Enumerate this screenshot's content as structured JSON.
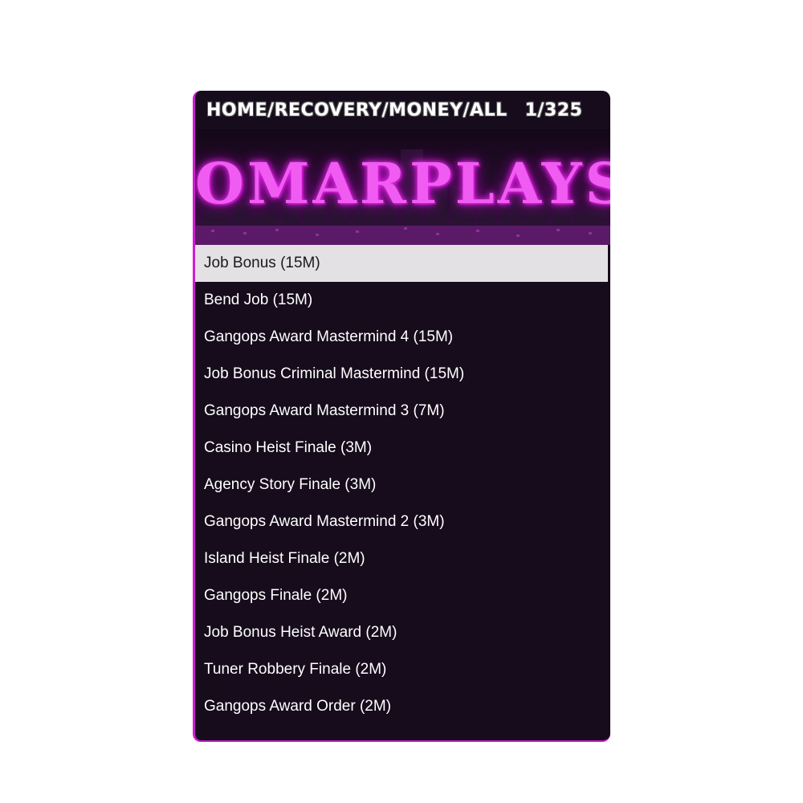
{
  "header": {
    "path": "HOME/RECOVERY/MONEY/ALL",
    "counter": "1/325"
  },
  "banner": {
    "title": "OMARPLAYS",
    "accent_color": "#e040f0"
  },
  "menu": {
    "selected_index": 0,
    "items": [
      {
        "label": "Job Bonus (15M)"
      },
      {
        "label": "Bend Job (15M)"
      },
      {
        "label": "Gangops Award Mastermind 4 (15M)"
      },
      {
        "label": "Job Bonus Criminal Mastermind (15M)"
      },
      {
        "label": "Gangops Award Mastermind 3 (7M)"
      },
      {
        "label": "Casino Heist Finale (3M)"
      },
      {
        "label": "Agency Story Finale (3M)"
      },
      {
        "label": "Gangops Award Mastermind 2 (3M)"
      },
      {
        "label": "Island Heist Finale (2M)"
      },
      {
        "label": "Gangops Finale (2M)"
      },
      {
        "label": "Job Bonus Heist Award (2M)"
      },
      {
        "label": "Tuner Robbery Finale (2M)"
      },
      {
        "label": "Gangops Award Order (2M)"
      }
    ]
  }
}
